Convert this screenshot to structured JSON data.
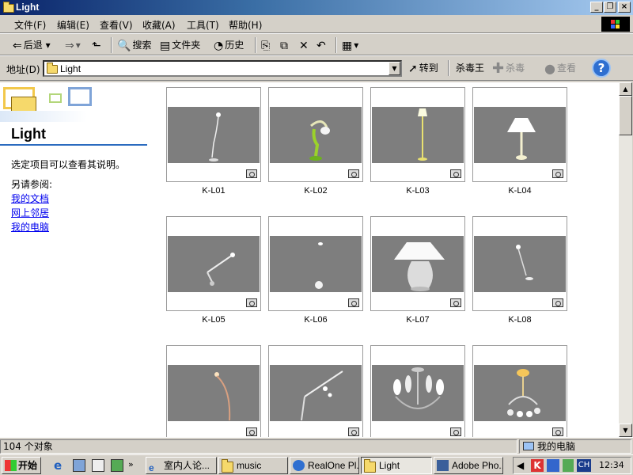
{
  "window": {
    "title": "Light"
  },
  "menu": [
    "文件(F)",
    "编辑(E)",
    "查看(V)",
    "收藏(A)",
    "工具(T)",
    "帮助(H)"
  ],
  "toolbar": {
    "back": "后退",
    "search": "搜索",
    "folders": "文件夹",
    "history": "历史"
  },
  "address": {
    "label": "地址(D)",
    "value": "Light",
    "go": "转到"
  },
  "antivirus": {
    "name": "杀毒王",
    "kill": "杀毒",
    "check": "查看"
  },
  "leftpane": {
    "title": "Light",
    "description": "选定项目可以查看其说明。",
    "see_also": "另请参阅:",
    "links": [
      "我的文档",
      "网上邻居",
      "我的电脑"
    ]
  },
  "items": [
    "K-L01",
    "K-L02",
    "K-L03",
    "K-L04",
    "K-L05",
    "K-L06",
    "K-L07",
    "K-L08",
    "",
    "",
    "",
    ""
  ],
  "status": {
    "count": "104 个对象",
    "location": "我的电脑"
  },
  "taskbar": {
    "start": "开始",
    "tasks": [
      "室内人论...",
      "music",
      "RealOne Pl...",
      "Light",
      "Adobe Pho..."
    ],
    "time": "12:34",
    "lang": "CH"
  }
}
